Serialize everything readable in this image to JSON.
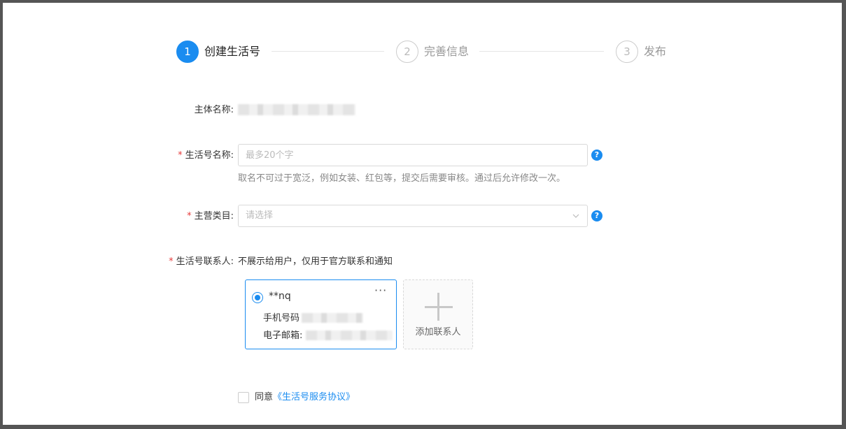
{
  "steps": [
    {
      "number": "1",
      "label": "创建生活号",
      "state": "active"
    },
    {
      "number": "2",
      "label": "完善信息",
      "state": "inactive"
    },
    {
      "number": "3",
      "label": "发布",
      "state": "inactive"
    }
  ],
  "form": {
    "entity_name_label": "主体名称:",
    "life_name_label": "生活号名称:",
    "life_name_placeholder": "最多20个字",
    "life_name_hint": "取名不可过于宽泛，例如女装、红包等，提交后需要审核。通过后允许修改一次。",
    "category_label": "主营类目:",
    "category_placeholder": "请选择",
    "contact_label": "生活号联系人:",
    "contact_note": "不展示给用户，仅用于官方联系和通知",
    "required_mark": "*",
    "help_glyph": "?"
  },
  "contact": {
    "name": "**nq",
    "more": "···",
    "phone_label": "手机号码",
    "email_label": "电子邮箱:"
  },
  "add_contact": {
    "label": "添加联系人"
  },
  "agreement": {
    "prefix": "同意",
    "link": "《生活号服务协议》"
  },
  "colors": {
    "accent": "#1a8cf0",
    "required": "#e63c3c"
  }
}
